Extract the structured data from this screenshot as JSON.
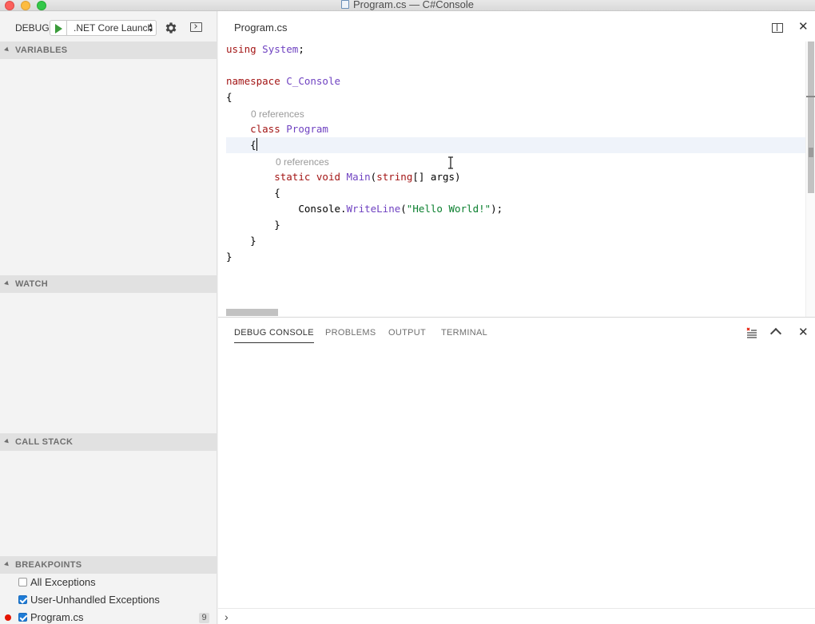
{
  "window": {
    "title": "Program.cs — C#Console"
  },
  "debug_toolbar": {
    "label": "DEBUG",
    "config_selected": ".NET Core Launch (console)"
  },
  "sections": {
    "variables": "VARIABLES",
    "watch": "WATCH",
    "call_stack": "CALL STACK",
    "breakpoints": "BREAKPOINTS"
  },
  "breakpoints": [
    {
      "label": "All Exceptions",
      "checked": false
    },
    {
      "label": "User-Unhandled Exceptions",
      "checked": true
    },
    {
      "label": "Program.cs",
      "checked": true,
      "line": "9"
    }
  ],
  "editor": {
    "tab": "Program.cs",
    "lenses": [
      "0 references",
      "0 references"
    ],
    "code": {
      "l1_kw": "using",
      "l1_ns": "System",
      "l1_end": ";",
      "l3_kw": "namespace",
      "l3_ns": "C_Console",
      "brace_open": "{",
      "brace_close": "}",
      "l5_kw": "class",
      "l5_type": "Program",
      "l7_static": "static",
      "l7_void": "void",
      "l7_fn": "Main",
      "l7_paren": "(",
      "l7_string": "string",
      "l7_rest": "[] args)",
      "l9_obj": "Console.",
      "l9_fn": "WriteLine",
      "l9_paren": "(",
      "l9_str": "\"Hello World!\"",
      "l9_end": ");"
    }
  },
  "panel": {
    "tabs": [
      "DEBUG CONSOLE",
      "PROBLEMS",
      "OUTPUT",
      "TERMINAL"
    ],
    "active_tab": "DEBUG CONSOLE",
    "prompt": "›"
  },
  "colors": {
    "breakpoint": "#e51400",
    "start_button": "#3a9b3a",
    "checkbox_checked": "#1e7bd6"
  }
}
